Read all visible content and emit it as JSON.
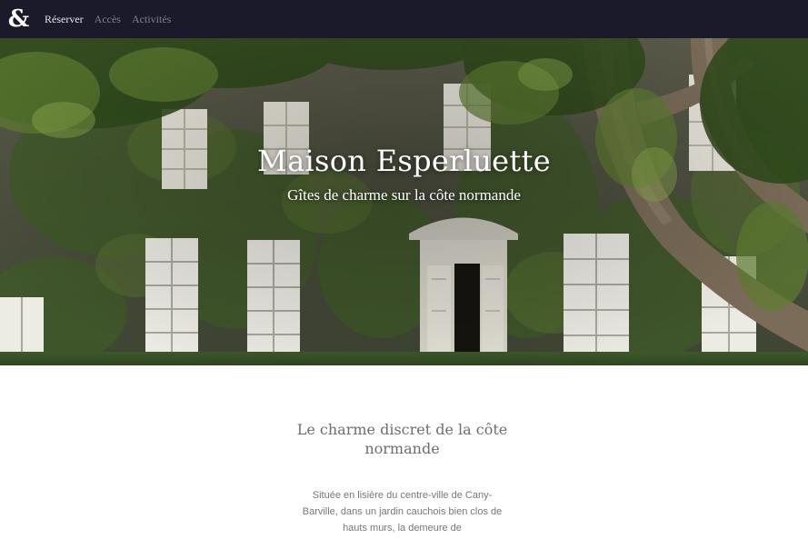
{
  "brand": {
    "symbol": "&"
  },
  "nav": {
    "items": [
      {
        "label": "Réserver",
        "active": true
      },
      {
        "label": "Accès",
        "active": false
      },
      {
        "label": "Activités",
        "active": false
      }
    ]
  },
  "hero": {
    "title": "Maison Esperluette",
    "subtitle": "Gîtes de charme sur la côte normande"
  },
  "intro": {
    "heading": "Le charme discret de la côte normande",
    "body": "Située en lisière du centre-ville de Cany-Barville, dans un jardin cauchois bien clos de hauts murs, la demeure de"
  },
  "colors": {
    "navbar_bg": "#1b1a2a",
    "nav_active": "#e6e5ec",
    "nav_inactive": "#7f7e8c",
    "heading_text": "#6e6e6e",
    "body_text": "#777777"
  }
}
